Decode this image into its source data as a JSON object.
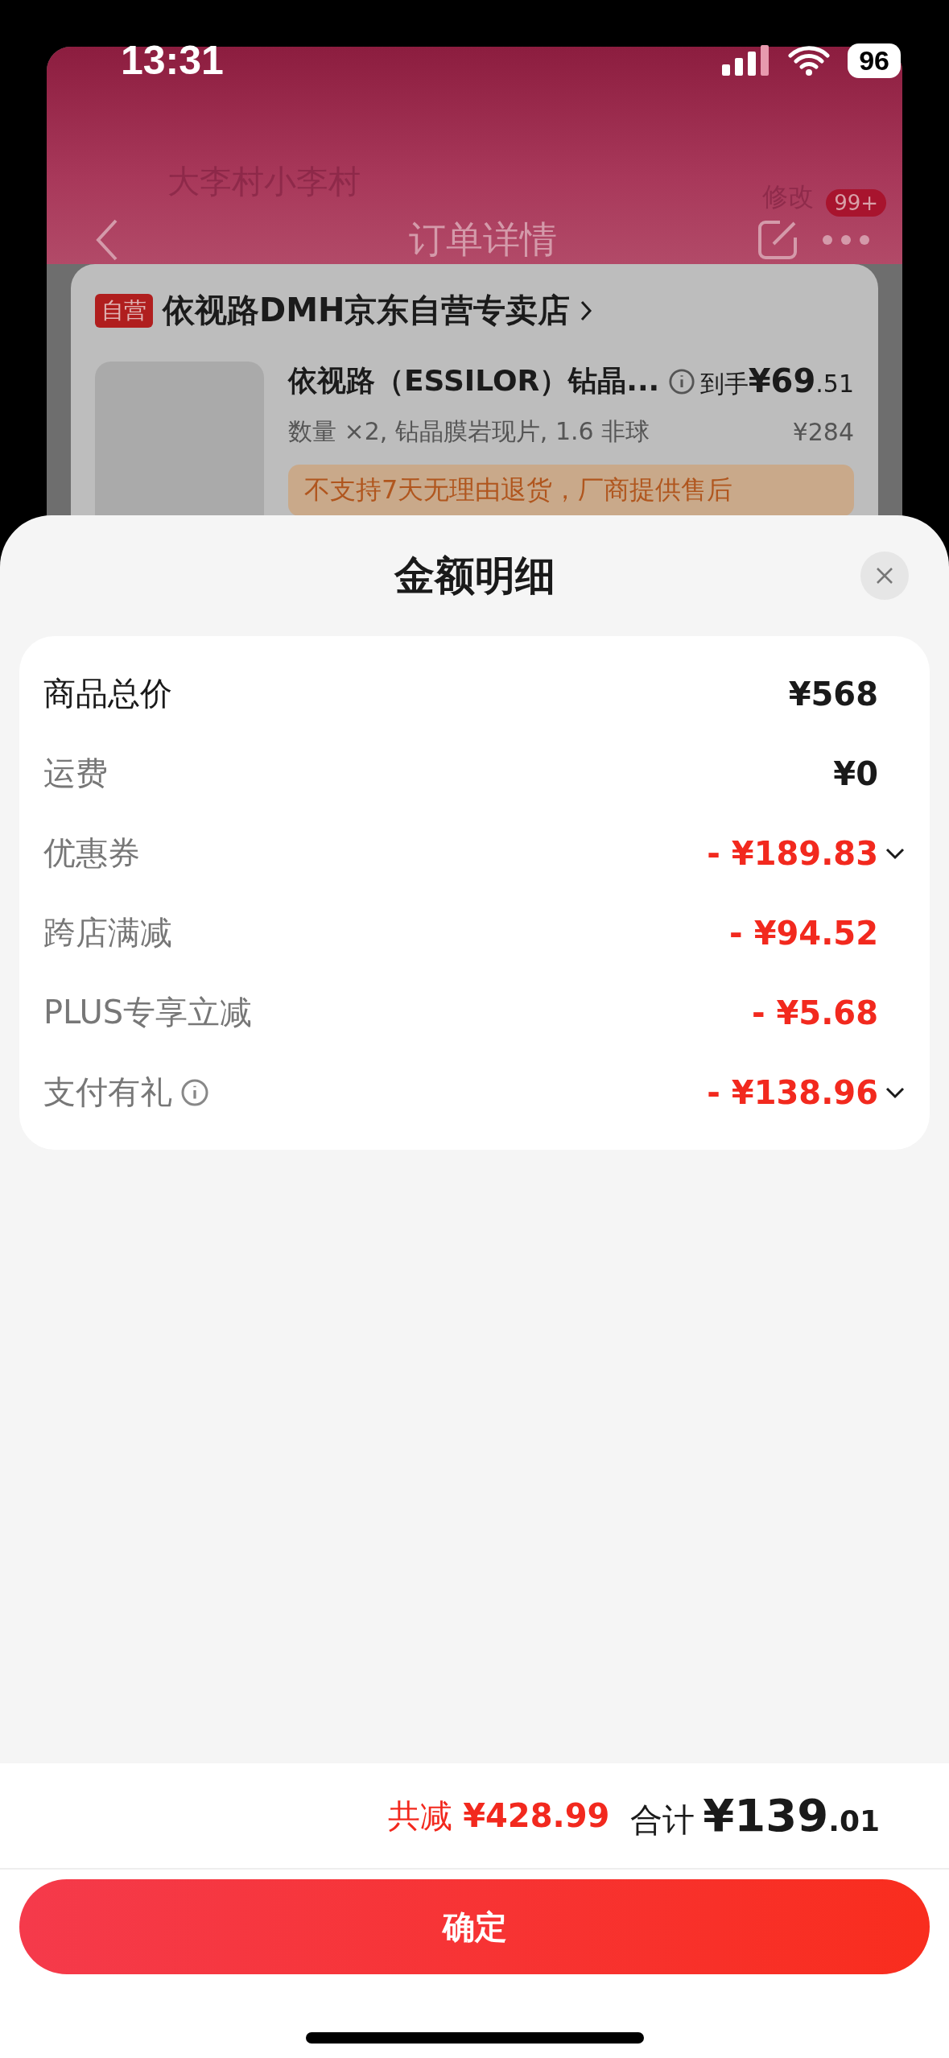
{
  "status_bar": {
    "time": "13:31",
    "battery": "96"
  },
  "background_page": {
    "address_name": "大李村小李村",
    "edit_link": "修改",
    "nav_title": "订单详情",
    "badge": "99+",
    "shop": {
      "tag": "自营",
      "name": "依视路DMH京东自营专卖店"
    },
    "product": {
      "title": "依视路（ESSILOR）钻晶...",
      "price_prefix": "到手",
      "price_int": "¥69",
      "price_dec": ".51",
      "spec": "数量 ×2, 钻晶膜岩现片, 1.6 非球",
      "original_price": "¥284",
      "notice": "不支持7天无理由退货，厂商提供售后"
    }
  },
  "sheet": {
    "title": "金额明细",
    "rows": [
      {
        "label": "商品总价",
        "value": "¥568",
        "kind": "total",
        "expandable": false,
        "info": false
      },
      {
        "label": "运费",
        "value": "¥0",
        "kind": "fee",
        "expandable": false,
        "info": false
      },
      {
        "label": "优惠券",
        "value": "- ¥189.83",
        "kind": "discount",
        "expandable": true,
        "info": false
      },
      {
        "label": "跨店满减",
        "value": "- ¥94.52",
        "kind": "discount",
        "expandable": false,
        "info": false
      },
      {
        "label": "PLUS专享立减",
        "value": "- ¥5.68",
        "kind": "discount",
        "expandable": false,
        "info": false
      },
      {
        "label": "支付有礼",
        "value": "- ¥138.96",
        "kind": "discount",
        "expandable": true,
        "info": true
      }
    ],
    "summary": {
      "reduced_label": "共减",
      "reduced_value": "¥428.99",
      "total_label": "合计",
      "total_int": "¥139",
      "total_dec": ".01"
    },
    "confirm_button": "确定"
  }
}
